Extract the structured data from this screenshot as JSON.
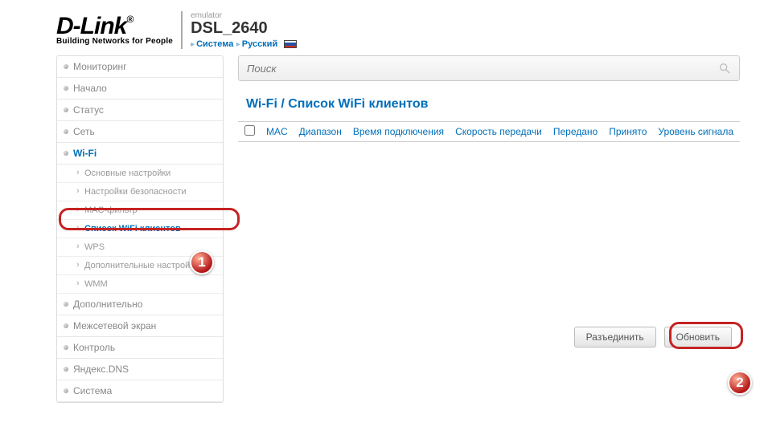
{
  "header": {
    "brand": "D-Link",
    "tagline": "Building Networks for People",
    "emulator": "emulator",
    "model": "DSL_2640",
    "crumb1": "Система",
    "crumb2": "Русский"
  },
  "sidebar": {
    "items": [
      "Мониторинг",
      "Начало",
      "Статус",
      "Сеть",
      "Wi-Fi",
      "Дополнительно",
      "Межсетевой экран",
      "Контроль",
      "Яндекс.DNS",
      "Система"
    ],
    "wifi_sub": [
      "Основные настройки",
      "Настройки безопасности",
      "MAC-фильтр",
      "Список WiFi клиентов",
      "WPS",
      "Дополнительные настройки",
      "WMM"
    ]
  },
  "search": {
    "placeholder": "Поиск"
  },
  "page": {
    "title": "Wi-Fi /  Список WiFi клиентов"
  },
  "table": {
    "headers": [
      "MAC",
      "Диапазон",
      "Время подключения",
      "Скорость передачи",
      "Передано",
      "Принято",
      "Уровень сигнала"
    ]
  },
  "buttons": {
    "disconnect": "Разъединить",
    "refresh": "Обновить"
  },
  "annotations": {
    "one": "1",
    "two": "2"
  }
}
